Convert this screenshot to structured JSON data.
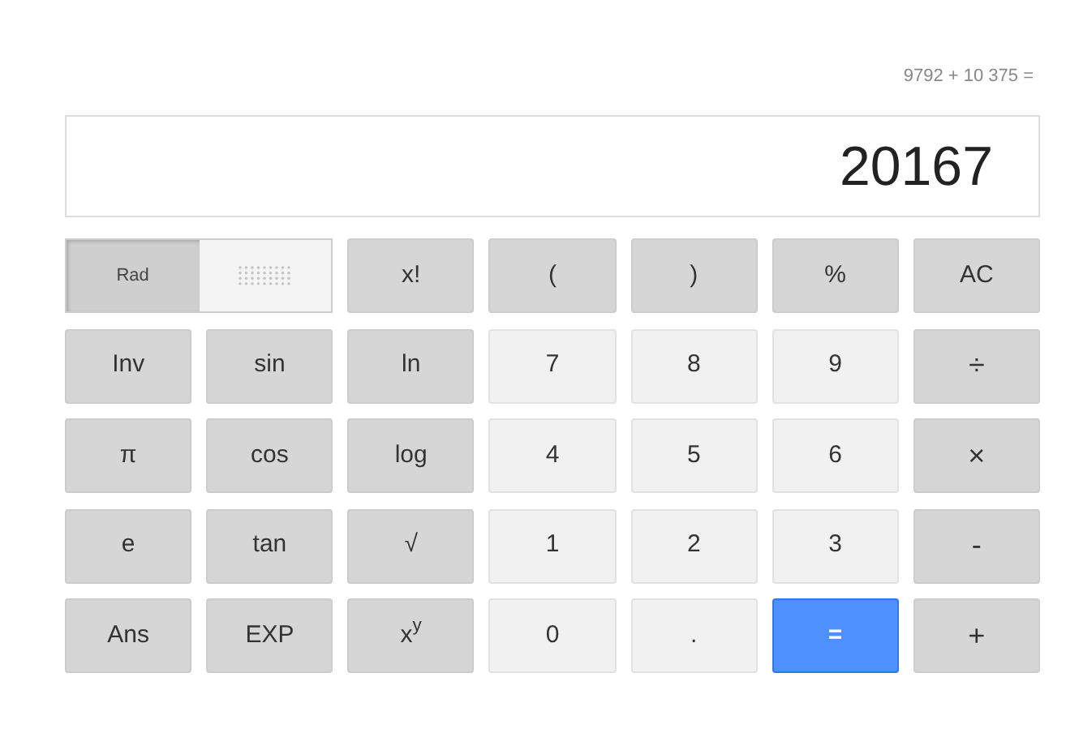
{
  "expression": "9792 + 10 375 =",
  "display": "20167",
  "angle_toggle": [
    {
      "label": "Rad",
      "selected": true
    },
    {
      "selected": false
    }
  ],
  "keys": [
    {
      "label": "x!",
      "kind": "function"
    },
    {
      "label": "(",
      "kind": "function"
    },
    {
      "label": ")",
      "kind": "function"
    },
    {
      "label": "%",
      "kind": "function"
    },
    {
      "label": "AC",
      "kind": "function"
    },
    {
      "label": "Inv",
      "kind": "function"
    },
    {
      "label": "sin",
      "kind": "function"
    },
    {
      "label": "ln",
      "kind": "function"
    },
    {
      "label": "7",
      "kind": "digit"
    },
    {
      "label": "8",
      "kind": "digit"
    },
    {
      "label": "9",
      "kind": "digit"
    },
    {
      "label": "÷",
      "kind": "operator"
    },
    {
      "label": "π",
      "kind": "function"
    },
    {
      "label": "cos",
      "kind": "function"
    },
    {
      "label": "log",
      "kind": "function"
    },
    {
      "label": "4",
      "kind": "digit"
    },
    {
      "label": "5",
      "kind": "digit"
    },
    {
      "label": "6",
      "kind": "digit"
    },
    {
      "label": "×",
      "kind": "operator"
    },
    {
      "label": "e",
      "kind": "function"
    },
    {
      "label": "tan",
      "kind": "function"
    },
    {
      "label": "√",
      "kind": "function"
    },
    {
      "label": "1",
      "kind": "digit"
    },
    {
      "label": "2",
      "kind": "digit"
    },
    {
      "label": "3",
      "kind": "digit"
    },
    {
      "label": "-",
      "kind": "operator"
    },
    {
      "label": "Ans",
      "kind": "function"
    },
    {
      "label": "EXP",
      "kind": "function"
    },
    {
      "label": "x$^{y}$",
      "kind": "function"
    },
    {
      "label": "0",
      "kind": "digit"
    },
    {
      "label": ".",
      "kind": "digit"
    },
    {
      "label": "=",
      "kind": "equals"
    },
    {
      "label": "+",
      "kind": "operator"
    }
  ]
}
